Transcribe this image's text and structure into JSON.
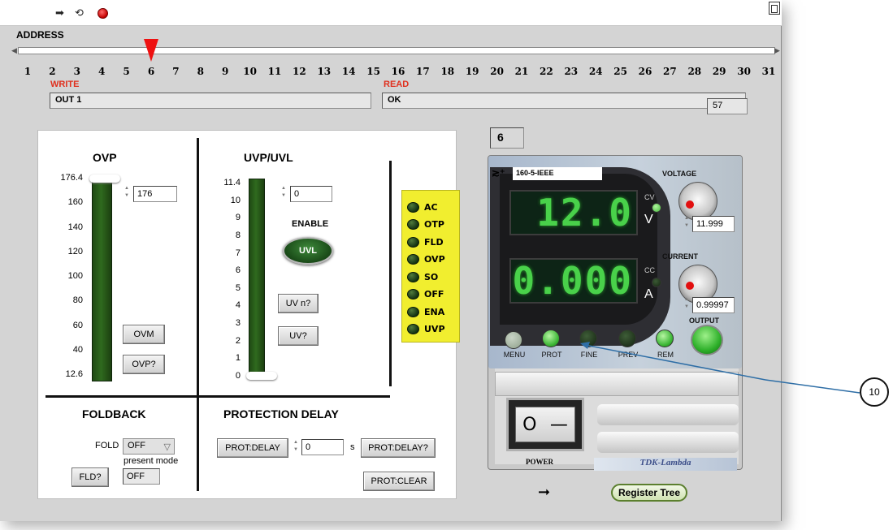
{
  "toolbar": {
    "run_icon": "➡",
    "run_cont_icon": "⟲",
    "stop_icon": "stop-icon"
  },
  "address": {
    "label": "ADDRESS",
    "ticks": [
      "1",
      "2",
      "3",
      "4",
      "5",
      "6",
      "7",
      "8",
      "9",
      "10",
      "11",
      "12",
      "13",
      "14",
      "15",
      "16",
      "17",
      "18",
      "19",
      "20",
      "21",
      "22",
      "23",
      "24",
      "25",
      "26",
      "27",
      "28",
      "29",
      "30",
      "31"
    ],
    "selected": 6
  },
  "write": {
    "label": "WRITE",
    "value": "OUT 1"
  },
  "read": {
    "label": "READ",
    "value": "OK",
    "count": "57"
  },
  "ovp": {
    "title": "OVP",
    "scale": [
      "176.4",
      "160",
      "140",
      "120",
      "100",
      "80",
      "60",
      "40",
      "12.6"
    ],
    "value": "176",
    "ovm_label": "OVM",
    "query_label": "OVP?"
  },
  "uvp": {
    "title": "UVP/UVL",
    "scale": [
      "11.4",
      "10",
      "9",
      "8",
      "7",
      "6",
      "5",
      "4",
      "3",
      "2",
      "1",
      "0"
    ],
    "value": "0",
    "enable_label": "ENABLE",
    "uvl_label": "UVL",
    "uvn_label": "UV n?",
    "uv_label": "UV?"
  },
  "status": {
    "items": [
      "AC",
      "OTP",
      "FLD",
      "OVP",
      "SO",
      "OFF",
      "ENA",
      "UVP"
    ]
  },
  "foldback": {
    "title": "FOLDBACK",
    "fold_label": "FOLD",
    "fold_value": "OFF",
    "present_mode_label": "present mode",
    "present_mode_value": "OFF",
    "query_label": "FLD?"
  },
  "protection": {
    "title": "PROTECTION DELAY",
    "delay_button": "PROT:DELAY",
    "delay_value": "0",
    "unit": "s",
    "delay_query": "PROT:DELAY?",
    "clear_button": "PROT:CLEAR"
  },
  "psu": {
    "address_display": "6",
    "model": "160-5-IEEE",
    "voltage_display": "12.0",
    "current_display": "0.000",
    "cv_label": "CV",
    "cc_label": "CC",
    "v_unit": "V",
    "a_unit": "A",
    "voltage_label": "VOLTAGE",
    "voltage_value": "11.999",
    "current_label": "CURRENT",
    "current_value": "0.99997",
    "output_label": "OUTPUT",
    "buttons": [
      "MENU",
      "PROT",
      "FINE",
      "PREV",
      "REM"
    ],
    "power_label": "POWER",
    "power_symbols": [
      "O",
      "—"
    ],
    "brand": "TDK-Lambda"
  },
  "register_tree": "Register Tree",
  "callout": "10",
  "colors": {
    "panel_bg": "#d4d4d4",
    "status_bg": "#f1ee2f",
    "accent_red": "#e0301e",
    "led_on": "#49d14a"
  }
}
